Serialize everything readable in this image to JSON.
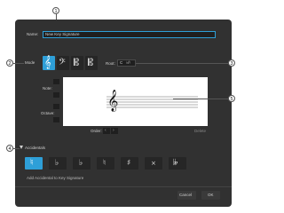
{
  "callouts": [
    "1",
    "2",
    "3",
    "4",
    "5"
  ],
  "name_field": {
    "label": "Name:",
    "value": "New Key Signature"
  },
  "modes_section": {
    "label": "Mode",
    "root_label": "Root:",
    "root_value": "C",
    "root_mode": "♭/♮",
    "clef_buttons": [
      "treble-clef",
      "bass-clef",
      "c-clef-alto",
      "c-clef-tenor"
    ]
  },
  "side_controls": {
    "note_label": "Note:",
    "octave_label": "Octave:"
  },
  "preview": {
    "order_label": "Order:",
    "delete_label": "Delete"
  },
  "accidentals_section": {
    "label": "Accidentals",
    "symbols": [
      "♮",
      "♭",
      "♭",
      "♮",
      "♯",
      "×",
      "𝄫"
    ],
    "hint": "Add Accidental to Key Signature"
  },
  "footer": {
    "cancel_label": "Cancel",
    "ok_label": "OK"
  },
  "colors": {
    "accent": "#2e9fd8",
    "dialog_bg": "#313131",
    "field_bg": "#1f1f1f"
  }
}
